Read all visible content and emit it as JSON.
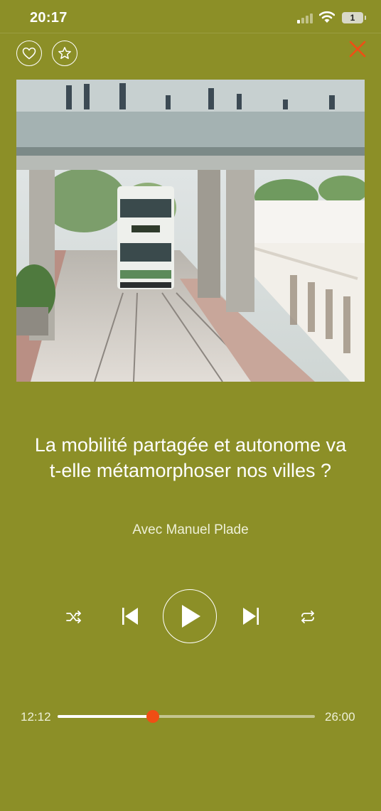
{
  "status_bar": {
    "time": "20:17",
    "battery": "1"
  },
  "player": {
    "title": "La mobilité partagée et autonome va t-elle métamorphoser nos villes ?",
    "author": "Avec Manuel Plade",
    "elapsed": "12:12",
    "duration": "26:00",
    "progress": 0.37,
    "cover_description": "urban tram under pedestrian skybridge"
  },
  "icons": {
    "like": "heart-icon",
    "favorite": "star-icon",
    "close": "close-icon",
    "shuffle": "shuffle-icon",
    "previous": "skip-back-icon",
    "play": "play-icon",
    "next": "skip-forward-icon",
    "repeat": "repeat-icon"
  },
  "colors": {
    "background": "#8c8f27",
    "accent": "#f04e14",
    "text": "#ffffff"
  }
}
